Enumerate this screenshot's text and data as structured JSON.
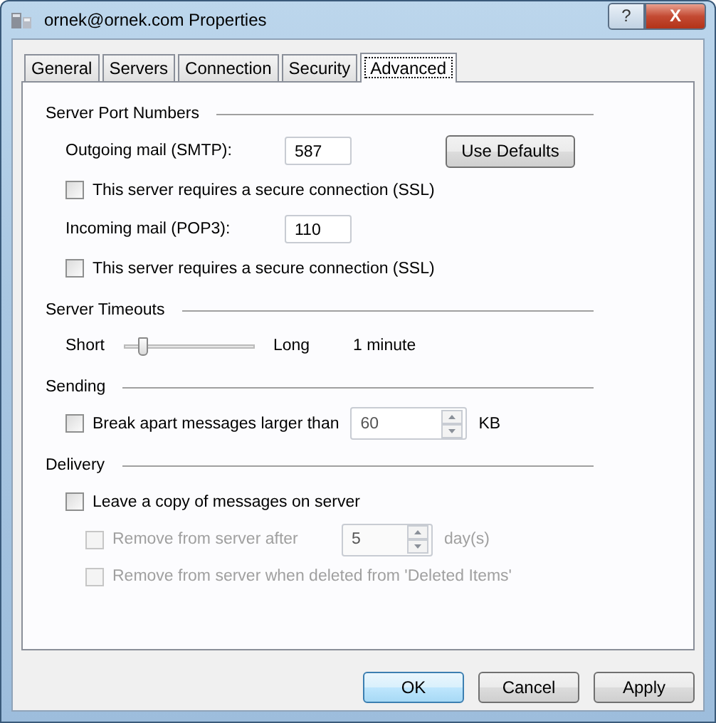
{
  "window": {
    "title": "ornek@ornek.com Properties",
    "help": "?",
    "close": "X"
  },
  "tabs": [
    {
      "label": "General",
      "selected": false
    },
    {
      "label": "Servers",
      "selected": false
    },
    {
      "label": "Connection",
      "selected": false
    },
    {
      "label": "Security",
      "selected": false
    },
    {
      "label": "Advanced",
      "selected": true
    }
  ],
  "sections": [
    {
      "title": "Server Port Numbers",
      "items": [
        {
          "kind": "field",
          "label": "Outgoing mail (SMTP):",
          "value": "587",
          "button": "Use Defaults"
        },
        {
          "kind": "checkbox",
          "label": "This server requires a secure connection (SSL)",
          "checked": false,
          "disabled": false
        },
        {
          "kind": "field",
          "label": "Incoming mail (POP3):",
          "value": "110"
        },
        {
          "kind": "checkbox",
          "label": "This server requires a secure connection (SSL)",
          "checked": false,
          "disabled": false
        }
      ]
    },
    {
      "title": "Server Timeouts",
      "items": [
        {
          "kind": "slider",
          "min_label": "Short",
          "max_label": "Long",
          "level": 0.13,
          "reading": "1 minute"
        }
      ]
    },
    {
      "title": "Sending",
      "items": [
        {
          "kind": "spin",
          "label": "Break apart messages larger than",
          "checked": false,
          "disabled": false,
          "value": "60",
          "unit": "KB"
        }
      ]
    },
    {
      "title": "Delivery",
      "items": [
        {
          "kind": "checkbox",
          "label": "Leave a copy of messages on server",
          "checked": false,
          "disabled": false,
          "children": [
            {
              "kind": "spin",
              "label": "Remove from server after",
              "checked": false,
              "disabled": true,
              "value": "5",
              "unit": "day(s)"
            },
            {
              "kind": "checkbox",
              "label": "Remove from server when deleted from 'Deleted Items'",
              "checked": false,
              "disabled": true
            }
          ]
        }
      ]
    }
  ],
  "buttons": [
    {
      "label": "OK",
      "default": true
    },
    {
      "label": "Cancel",
      "default": false
    },
    {
      "label": "Apply",
      "default": false
    }
  ]
}
